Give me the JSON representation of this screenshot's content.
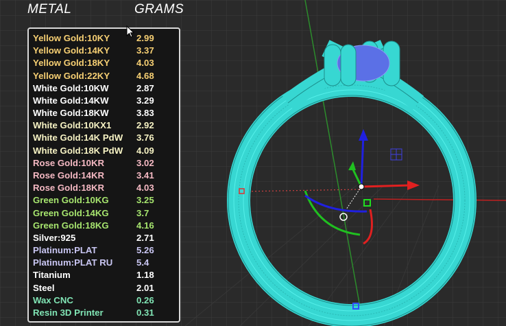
{
  "header": {
    "metal_label": "METAL",
    "grams_label": "GRAMS"
  },
  "colors": {
    "yellow": "#f6cf73",
    "white": "#ffffff",
    "whitecream": "#f7f3c4",
    "rose": "#f5b9c3",
    "green": "#a6e46e",
    "platinum": "#c9c6f2",
    "wax": "#80e4b4",
    "ring": "#3ddfd9",
    "gem": "#5b70e6"
  },
  "metals": [
    {
      "name": "Yellow Gold:10KY",
      "grams": "2.99",
      "color": "#f6cf73"
    },
    {
      "name": "Yellow Gold:14KY",
      "grams": "3.37",
      "color": "#f6cf73"
    },
    {
      "name": "Yellow Gold:18KY",
      "grams": "4.03",
      "color": "#f6cf73"
    },
    {
      "name": "Yellow Gold:22KY",
      "grams": "4.68",
      "color": "#f6cf73"
    },
    {
      "name": "White Gold:10KW",
      "grams": "2.87",
      "color": "#ffffff"
    },
    {
      "name": "White Gold:14KW",
      "grams": "3.29",
      "color": "#ffffff"
    },
    {
      "name": "White Gold:18KW",
      "grams": "3.83",
      "color": "#ffffff"
    },
    {
      "name": "White Gold:10KX1",
      "grams": "2.92",
      "color": "#f7f3c4"
    },
    {
      "name": "White Gold:14K PdW",
      "grams": "3.76",
      "color": "#f7f3c4"
    },
    {
      "name": "White Gold:18K PdW",
      "grams": "4.09",
      "color": "#f7f3c4"
    },
    {
      "name": "Rose Gold:10KR",
      "grams": "3.02",
      "color": "#f5b9c3"
    },
    {
      "name": "Rose Gold:14KR",
      "grams": "3.41",
      "color": "#f5b9c3"
    },
    {
      "name": "Rose Gold:18KR",
      "grams": "4.03",
      "color": "#f5b9c3"
    },
    {
      "name": "Green Gold:10KG",
      "grams": "3.25",
      "color": "#a6e46e"
    },
    {
      "name": "Green Gold:14KG",
      "grams": "3.7",
      "color": "#a6e46e"
    },
    {
      "name": "Green Gold:18KG",
      "grams": "4.16",
      "color": "#a6e46e"
    },
    {
      "name": "Silver:925",
      "grams": "2.71",
      "color": "#ffffff"
    },
    {
      "name": "Platinum:PLAT",
      "grams": "5.26",
      "color": "#c9c6f2"
    },
    {
      "name": "Platinum:PLAT RU",
      "grams": "5.4",
      "color": "#c9c6f2"
    },
    {
      "name": "Titanium",
      "grams": "1.18",
      "color": "#ffffff"
    },
    {
      "name": "Steel",
      "grams": "2.01",
      "color": "#ffffff"
    },
    {
      "name": "Wax  CNC",
      "grams": "0.26",
      "color": "#80e4b4"
    },
    {
      "name": "Resin 3D Printer",
      "grams": "0.31",
      "color": "#80e4b4"
    }
  ]
}
